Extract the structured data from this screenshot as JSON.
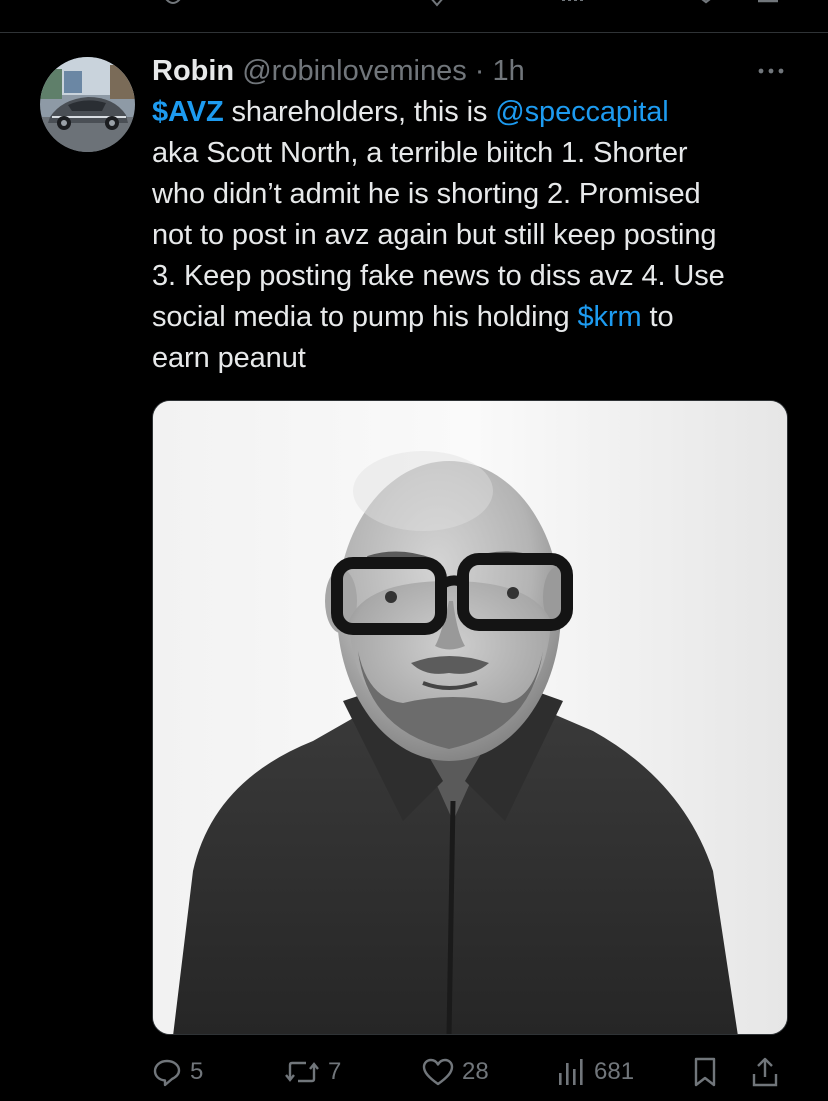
{
  "tweet": {
    "author_name": "Robin",
    "handle": "@robinlovemines",
    "separator": "·",
    "time": "1h",
    "text": {
      "l1_cashtag": "$AVZ",
      "l1_mid": " shareholders, this is ",
      "l1_mention": "@speccapital",
      "l2": "aka Scott North, a terrible biitch 1. Shorter",
      "l3": "who didn’t admit he is shorting 2. Promised",
      "l4": "not to post in avz again but still keep posting",
      "l5": "3. Keep posting fake news to diss avz 4. Use",
      "l6_pre": "social media to pump his holding ",
      "l6_cashtag": "$krm",
      "l6_post": " to",
      "l7": "earn peanut"
    },
    "media_alt": "",
    "metrics": {
      "replies": "5",
      "reposts": "7",
      "likes": "28",
      "views": "681"
    }
  },
  "icons": {
    "more": "more-horizontal-icon",
    "reply": "reply-icon",
    "repost": "repost-icon",
    "like": "heart-icon",
    "views": "views-icon",
    "bookmark": "bookmark-icon",
    "share": "share-icon"
  },
  "colors": {
    "background": "#000000",
    "text": "#e7e9ea",
    "secondary": "#71767b",
    "link": "#1d9bf0",
    "divider": "#2f3336"
  }
}
